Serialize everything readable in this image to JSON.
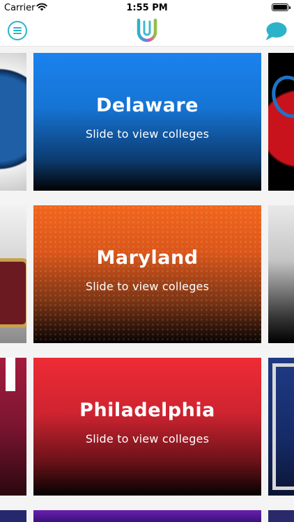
{
  "status_bar": {
    "carrier": "Carrier",
    "time": "1:55 PM"
  },
  "nav": {
    "menu_icon": "menu-icon",
    "logo_icon": "u-logo-icon",
    "chat_icon": "chat-bubble-icon",
    "accent_color": "#2cb3c9"
  },
  "cards": [
    {
      "title": "Delaware",
      "subtitle": "Slide to view colleges",
      "color": "#1a82ee"
    },
    {
      "title": "Maryland",
      "subtitle": "Slide to view colleges",
      "color": "#f2661d"
    },
    {
      "title": "Philadelphia",
      "subtitle": "Slide to view colleges",
      "color": "#ee2b35"
    },
    {
      "title": "",
      "subtitle": "",
      "color": "#6a1fb0"
    }
  ]
}
